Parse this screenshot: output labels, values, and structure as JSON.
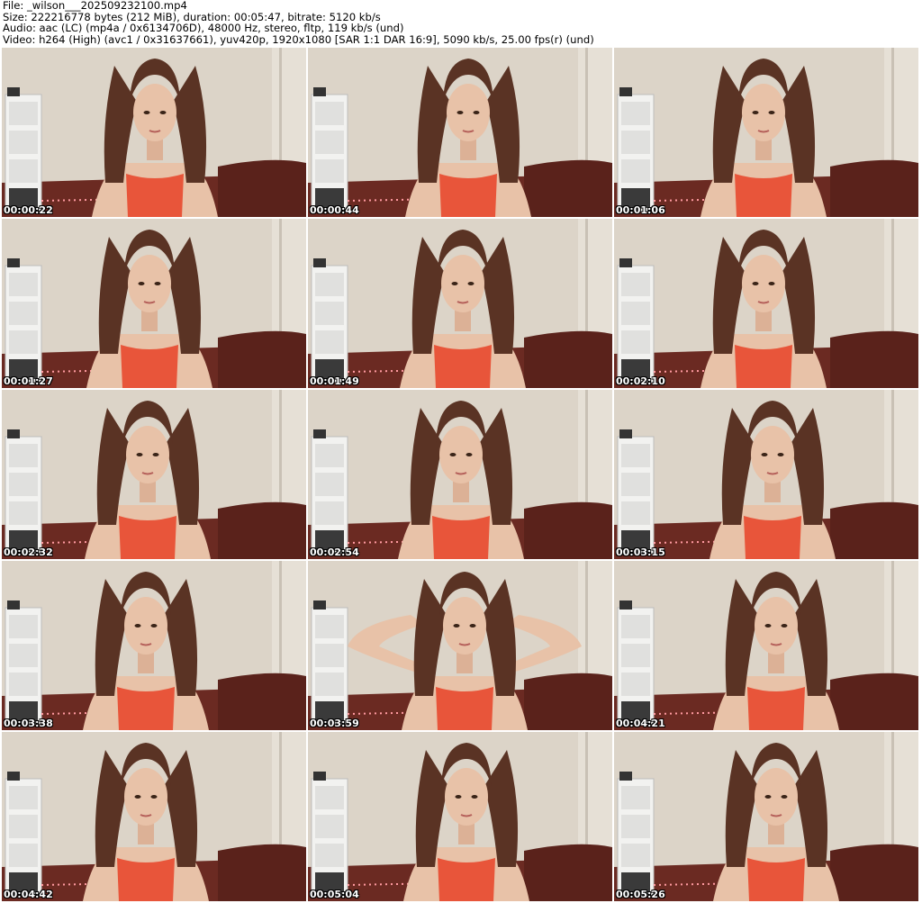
{
  "header": {
    "file_line": "File: _wilson___202509232100.mp4",
    "size_line": "Size: 222216778 bytes (212 MiB), duration: 00:05:47, bitrate: 5120 kb/s",
    "audio_line": "Audio: aac (LC) (mp4a / 0x6134706D), 48000 Hz, stereo, fltp, 119 kb/s (und)",
    "video_line": "Video: h264 (High) (avc1 / 0x31637661), yuv420p, 1920x1080 [SAR 1:1 DAR 16:9], 5090 kb/s, 25.00 fps(r) (und)"
  },
  "thumbnails": [
    {
      "timestamp": "00:00:22"
    },
    {
      "timestamp": "00:00:44"
    },
    {
      "timestamp": "00:01:06"
    },
    {
      "timestamp": "00:01:27"
    },
    {
      "timestamp": "00:01:49"
    },
    {
      "timestamp": "00:02:10"
    },
    {
      "timestamp": "00:02:32"
    },
    {
      "timestamp": "00:02:54"
    },
    {
      "timestamp": "00:03:15"
    },
    {
      "timestamp": "00:03:38"
    },
    {
      "timestamp": "00:03:59"
    },
    {
      "timestamp": "00:04:21"
    },
    {
      "timestamp": "00:04:42"
    },
    {
      "timestamp": "00:05:04"
    },
    {
      "timestamp": "00:05:26"
    }
  ],
  "colors": {
    "wall": "#dcd4c8",
    "bed": "#6b2a22",
    "top": "#e8553a",
    "hair": "#5a3324",
    "skin": "#e8c2a8"
  }
}
